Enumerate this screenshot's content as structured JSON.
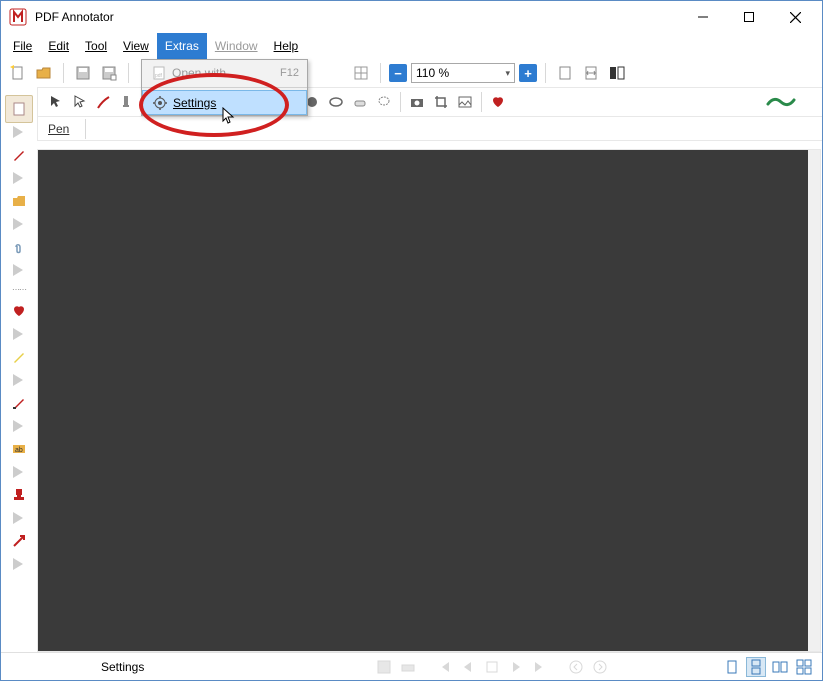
{
  "title": "PDF Annotator",
  "menubar": {
    "file": "File",
    "edit": "Edit",
    "tool": "Tool",
    "view": "View",
    "extras": "Extras",
    "window": "Window",
    "help": "Help"
  },
  "dropdown": {
    "open_with": "Open with ...",
    "open_with_shortcut": "F12",
    "settings": "Settings"
  },
  "toolbar": {
    "zoom_value": "110 %"
  },
  "properties": {
    "tool_label": "Pen"
  },
  "statusbar": {
    "hint": "Settings"
  }
}
